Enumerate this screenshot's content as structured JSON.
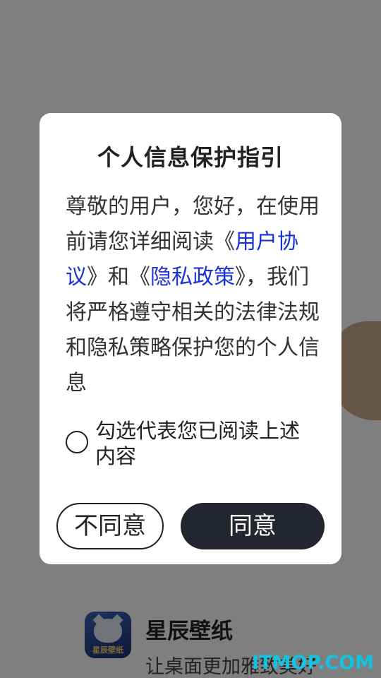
{
  "dialog": {
    "title": "个人信息保护指引",
    "body_intro": "尊敬的用户，您好，在使用前请您详细阅读《",
    "link_user_agreement": "用户协议",
    "body_mid": "》和《",
    "link_privacy_policy": "隐私政策",
    "body_outro": "》，我们将严格遵守相关的法律法规和隐私策略保护您的个人信息",
    "consent_label": "勾选代表您已阅读上述内容",
    "consent_checked": false,
    "disagree_label": "不同意",
    "agree_label": "同意"
  },
  "background": {
    "app_name": "星辰壁纸",
    "app_slogan": "让桌面更加雅致美好",
    "logo_text": "星辰壁纸"
  },
  "watermark": "ITMOP.COM",
  "colors": {
    "overlay": "rgba(0,0,0,0.5)",
    "link": "#1a32d8",
    "agree_button": "#23262e",
    "watermark": "#13c4e0"
  }
}
